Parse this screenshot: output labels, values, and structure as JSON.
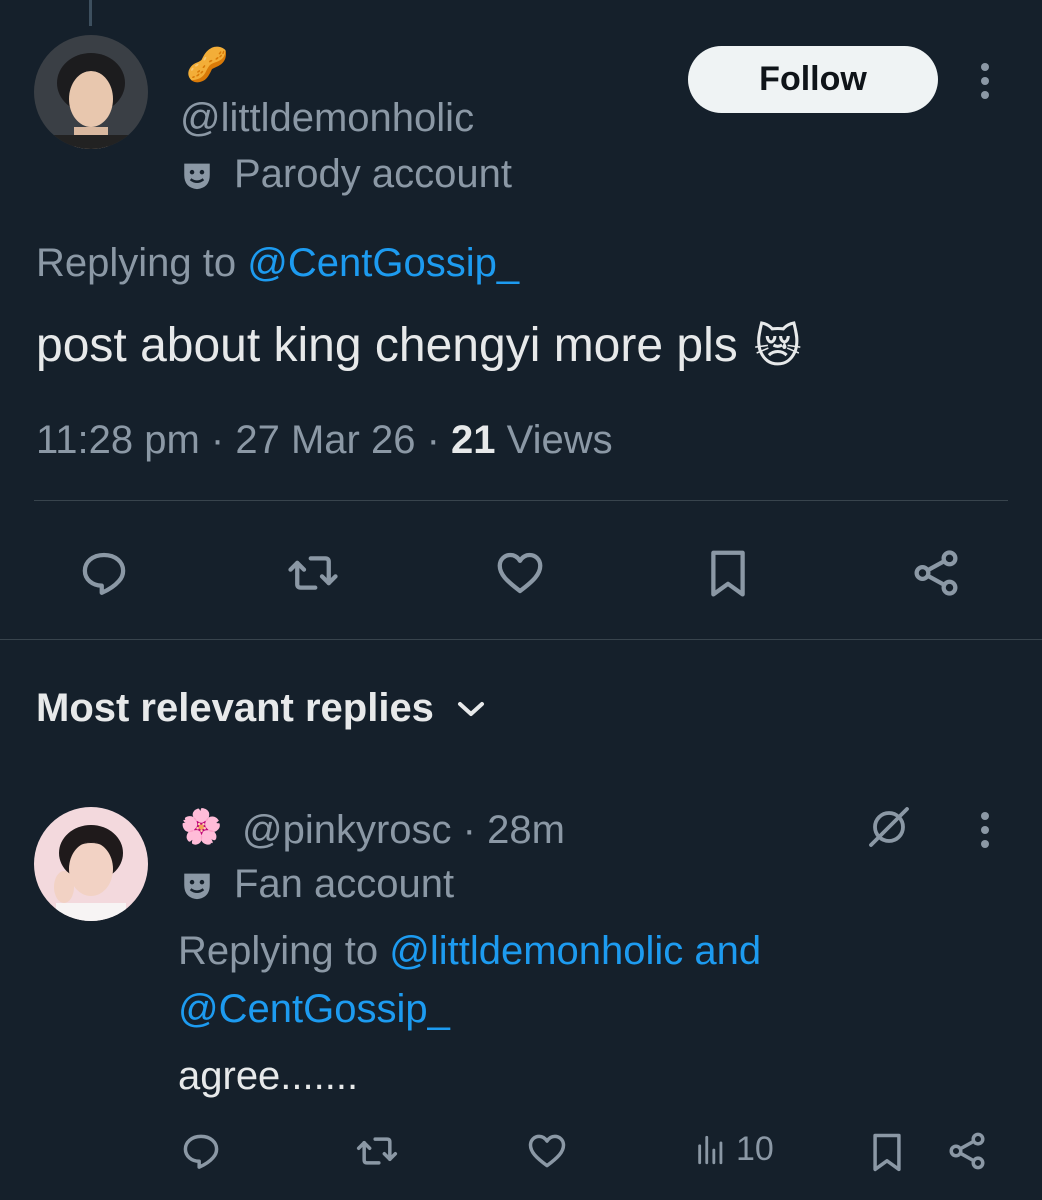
{
  "main_post": {
    "display_name_emoji": "🥜",
    "handle": "@littldemonholic",
    "account_label": "Parody account",
    "follow_label": "Follow",
    "replying_prefix": "Replying to ",
    "replying_handle": "@CentGossip_",
    "text": "post about king chengyi more pls",
    "text_emoji": "😿",
    "time": "11:28 pm",
    "separator": " · ",
    "date": "27 Mar 26",
    "views_count": "21",
    "views_label": " Views"
  },
  "actions": {
    "reply_icon": "reply-icon",
    "retweet_icon": "retweet-icon",
    "like_icon": "heart-icon",
    "bookmark_icon": "bookmark-icon",
    "share_icon": "share-icon"
  },
  "replies_section": {
    "title": "Most relevant replies"
  },
  "reply": {
    "display_name_emoji": "🌸",
    "handle": "@pinkyrosc",
    "time_separator": " · ",
    "time": "28m",
    "account_label": "Fan account",
    "replying_prefix": "Replying to ",
    "replying_handle_1": "@littldemonholic",
    "replying_and": " and",
    "replying_handle_2": "@CentGossip_",
    "text": "agree.......",
    "views": "10"
  },
  "colors": {
    "background": "#15202b",
    "text": "#e7e9ea",
    "muted": "#8b98a5",
    "link": "#1d9bf0",
    "divider": "#38444d"
  }
}
